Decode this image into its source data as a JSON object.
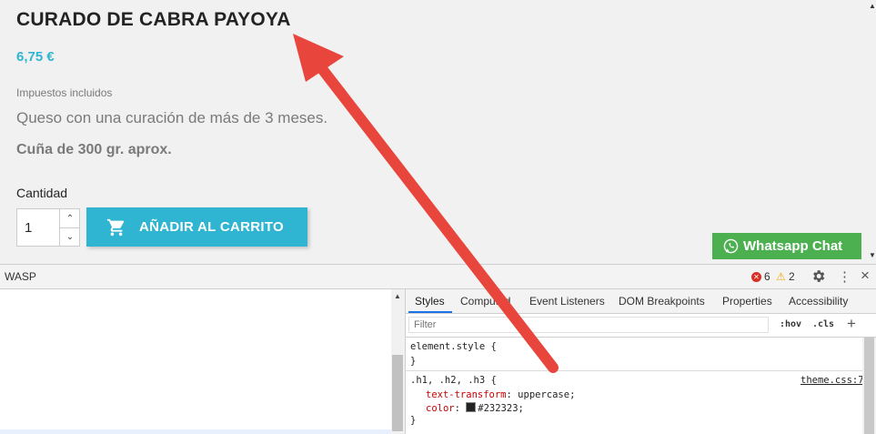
{
  "product": {
    "title": "CURADO DE CABRA PAYOYA",
    "price": "6,75 €",
    "tax_note": "Impuestos incluidos",
    "description": "Queso con una curación de más de 3 meses.",
    "weight_note": "Cuña de 300 gr. aprox.",
    "quantity_label": "Cantidad",
    "quantity_value": "1",
    "add_to_cart_label": "AÑADIR AL CARRITO"
  },
  "whatsapp": {
    "label": "Whatsapp Chat"
  },
  "devtools": {
    "title": "WASP",
    "error_count": "6",
    "warning_count": "2",
    "tabs": [
      {
        "label": "Styles"
      },
      {
        "label": "Computed"
      },
      {
        "label": "Event Listeners"
      },
      {
        "label": "DOM Breakpoints"
      },
      {
        "label": "Properties"
      },
      {
        "label": "Accessibility"
      }
    ],
    "filter_placeholder": "Filter",
    "hov_label": ":hov",
    "cls_label": ".cls",
    "plus_label": "+",
    "element_style_open": "element.style {",
    "close_brace": "}",
    "rule_selector": ".h1, .h2, .h3 {",
    "rule_source": "theme.css:7",
    "prop1_name": "text-transform",
    "prop1_value": "uppercase;",
    "prop2_name": "color",
    "prop2_value": "#232323;"
  },
  "colors": {
    "accent": "#2fb5d2",
    "whatsapp_green": "#4caf50",
    "annotation_arrow": "#e8453c",
    "title_text": "#232323"
  }
}
